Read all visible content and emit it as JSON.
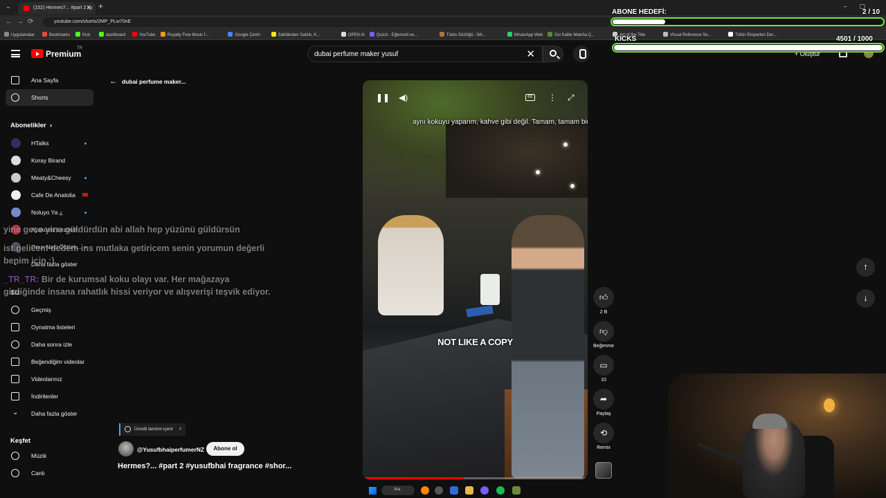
{
  "browser": {
    "tab_title": "(152) Hermes?... #part 2 #y",
    "url": "youtube.com/shorts/2MP_PLw70nE",
    "bookmarks": [
      {
        "label": "Uygulamalar",
        "color": "#888888"
      },
      {
        "label": "Bookmarks",
        "color": "#e74c3c"
      },
      {
        "label": "Kick",
        "color": "#53fc18"
      },
      {
        "label": "dashboard",
        "color": "#53fc18"
      },
      {
        "label": "YouTube",
        "color": "#ff0000"
      },
      {
        "label": "Royalty Free Music f...",
        "color": "#f39c12"
      },
      {
        "label": "Google Çeviri",
        "color": "#4285f4"
      },
      {
        "label": "Sahibinden Satılık, K...",
        "color": "#ffe800"
      },
      {
        "label": "OPEN AI",
        "color": "#dddddd"
      },
      {
        "label": "Quizzi - Eğlenceli ve...",
        "color": "#7a5cff"
      },
      {
        "label": "Tütün Sözlüğü - İkti...",
        "color": "#aa7744"
      },
      {
        "label": "WhatsApp Web",
        "color": "#25d366"
      },
      {
        "label": "Üst Kalite Matcha Ç...",
        "color": "#5a8a3a"
      },
      {
        "label": "Art of the Title",
        "color": "#cccccc"
      },
      {
        "label": "Visual Reference Se...",
        "color": "#bbbbbb"
      },
      {
        "label": "Tütün Eksperleri Der...",
        "color": "#ffffff"
      }
    ]
  },
  "header": {
    "logo_text": "Premium",
    "logo_country": "TR",
    "search_query": "dubai perfume maker yusuf",
    "create_label": "Oluştur"
  },
  "sidebar": {
    "top": [
      {
        "label": "Ana Sayfa",
        "icon": "home-icon"
      },
      {
        "label": "Shorts",
        "icon": "shorts-icon"
      }
    ],
    "subs_title": "Abonelikler",
    "subs": [
      {
        "label": "HTalks",
        "color": "#303060",
        "badge": "dot"
      },
      {
        "label": "Koray Birand",
        "color": "#dddddd",
        "badge": ""
      },
      {
        "label": "Meaty&Cheesy",
        "color": "#cccccc",
        "badge": "dot"
      },
      {
        "label": "Cafe De Anatolia",
        "color": "#eeeeee",
        "badge": "flag"
      },
      {
        "label": "Noluyo Ya ¿",
        "color": "#7788cc",
        "badge": "dot"
      },
      {
        "label": "Ayaküstü Lezzetli",
        "color": "#cc3344",
        "badge": ""
      },
      {
        "label": "Onur Naci Öztürk...",
        "color": "#555566",
        "badge": "dot"
      }
    ],
    "subs_more": "Daha fazla göster",
    "you_title": "Siz",
    "you": [
      {
        "label": "Geçmiş",
        "icon": "history-icon"
      },
      {
        "label": "Oynatma listeleri",
        "icon": "playlists-icon"
      },
      {
        "label": "Daha sonra izle",
        "icon": "watch-later-icon"
      },
      {
        "label": "Beğendiğim videolar",
        "icon": "liked-videos-icon"
      },
      {
        "label": "Videolarınız",
        "icon": "your-videos-icon"
      },
      {
        "label": "İndirilenler",
        "icon": "downloads-icon"
      }
    ],
    "you_more": "Daha fazla göster",
    "explore_title": "Keşfet",
    "explore": [
      {
        "label": "Müzik",
        "icon": "music-icon"
      },
      {
        "label": "Canlı",
        "icon": "live-icon"
      }
    ]
  },
  "back_label": "dubai perfume maker...",
  "chat": [
    {
      "user": "",
      "text": "yine gece yine güldürdün abi allah hep yüzünü güldürsün"
    },
    {
      "user": "",
      "text": "ist gelicem dedem ins mutlaka getiricem senin yorumun değerli benim için :)"
    },
    {
      "user": "_TR_TR:",
      "text": "Bir de kurumsal koku olayı var. Her mağazaya girdiğinde insana rahatlık hissi veriyor ve alışverişi teşvik ediyor."
    }
  ],
  "video": {
    "caption": "aynı kokuyu yaparım, kahve gibi değil. Tamam, tamam bir",
    "overlay_text": "NOT LIKE A COPY",
    "progress": 0.45
  },
  "actions": {
    "like_count": "2 B",
    "dislike_label": "Beğenme",
    "comments_count": "10",
    "share_label": "Paylaş",
    "remix_label": "Remix"
  },
  "channel": {
    "promo_label": "Ücretli tanıtım içerir",
    "handle": "@YusufbhaiperfumerNZ",
    "subscribe_label": "Abone ol",
    "title": "Hermes?... #part 2 #yusufbhai  fragrance #shor..."
  },
  "stream": {
    "goal_title": "ABONE HEDEFİ:",
    "goal_count": "2 / 10",
    "goal_progress": 0.2,
    "kicks_title": "KICKS",
    "kicks_count": "4501  / 1000",
    "kicks_progress": 1.0
  },
  "taskbar": {
    "search_label": "Ara"
  }
}
